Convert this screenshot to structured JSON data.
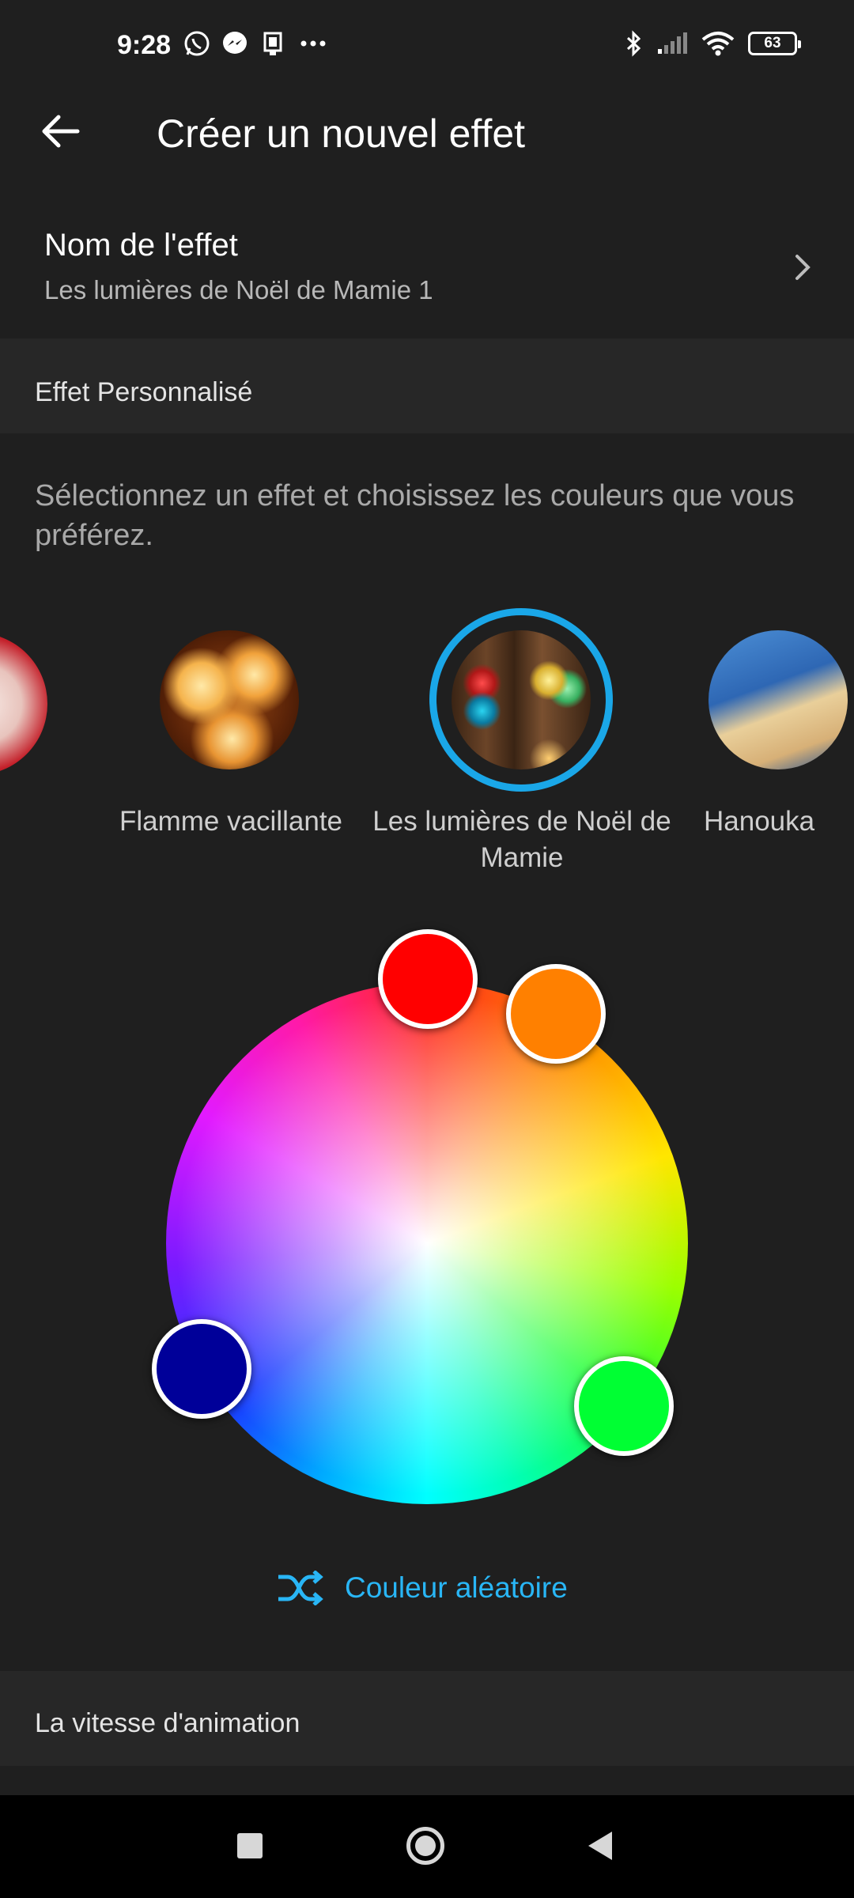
{
  "status_bar": {
    "time": "9:28",
    "battery": "63",
    "icons": [
      "whatsapp-icon",
      "messenger-icon",
      "device-icon",
      "more-dots-icon",
      "bluetooth-icon",
      "signal-icon",
      "wifi-icon",
      "battery-icon"
    ]
  },
  "header": {
    "title": "Créer un nouvel effet",
    "back_icon": "arrow-left-icon"
  },
  "effect_name": {
    "label": "Nom de l'effet",
    "value": "Les lumières de Noël de Mamie 1"
  },
  "custom_section": {
    "title": "Effet Personnalisé",
    "description": "Sélectionnez un effet et choisissez les couleurs que vous préférez."
  },
  "effects": [
    {
      "label": "",
      "selected": false
    },
    {
      "label": "Flamme vacillante",
      "selected": false
    },
    {
      "label": "Les lumières de Noël de Mamie",
      "selected": true
    },
    {
      "label": "Hanouka",
      "selected": false
    }
  ],
  "color_picker": {
    "handles": [
      "#ff0000",
      "#ff8000",
      "#000099",
      "#00ff33"
    ],
    "accent": "#29b6f6"
  },
  "random_color": {
    "label": "Couleur aléatoire",
    "icon": "shuffle-icon"
  },
  "speed_section": {
    "title": "La vitesse d'animation"
  },
  "nav_bar": {
    "icons": [
      "recents-square-icon",
      "home-circle-icon",
      "back-triangle-icon"
    ]
  }
}
